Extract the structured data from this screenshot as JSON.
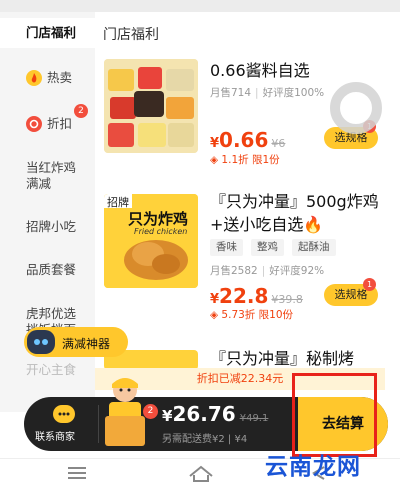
{
  "header": {
    "title": "门店福利"
  },
  "sidebar": {
    "items": [
      {
        "label": "门店福利"
      },
      {
        "label": "热卖"
      },
      {
        "label": "折扣",
        "badge": "2"
      },
      {
        "label": "当红炸鸡满减"
      },
      {
        "label": "招牌小吃"
      },
      {
        "label": "品质套餐"
      },
      {
        "label": "虎邦优选拌饭拌面"
      },
      {
        "label": "开心主食"
      }
    ]
  },
  "products": [
    {
      "title": "0.66酱料自选",
      "sales": "月售714",
      "rating": "好评度100%",
      "price": "0.66",
      "original_price": "¥6",
      "discount": "1.1折 限1份",
      "spec_label": "选规格",
      "spec_badge": "1"
    },
    {
      "title": "『只为冲量』500g炸鸡+送小吃自选🔥",
      "tags": [
        "香味",
        "整鸡",
        "起酥油"
      ],
      "sales": "月售2582",
      "rating": "好评度92%",
      "price": "22.8",
      "original_price": "¥39.8",
      "discount": "5.73折 限10份",
      "spec_label": "选规格",
      "spec_badge": "1",
      "image_text": "招牌",
      "image_text2": "只为炸鸡",
      "image_text3": "Fried chicken"
    },
    {
      "title": "『只为冲量』秘制烤"
    }
  ],
  "promo": {
    "manjian_label": "满减神器"
  },
  "cart": {
    "discount_note": "折扣已减22.34元",
    "contact_label": "联系商家",
    "count_badge": "2",
    "total": "26.76",
    "original_total": "49.1",
    "delivery_note": "另需配送费¥2 | ¥4",
    "checkout_label": "去结算"
  },
  "watermark": "云南龙网",
  "colors": {
    "accent_yellow": "#ffc72c",
    "price_red": "#f0410f",
    "badge_red": "#f24e3d",
    "highlight_frame": "#e8221a",
    "cart_dark": "#222222"
  },
  "icons": {
    "hot": "flame-icon",
    "discount": "discount-tag-icon",
    "contact": "chat-bubble-icon",
    "discount_tag": "coupon-icon",
    "nav_menu": "menu-icon",
    "nav_home": "home-icon",
    "nav_back": "back-icon"
  }
}
